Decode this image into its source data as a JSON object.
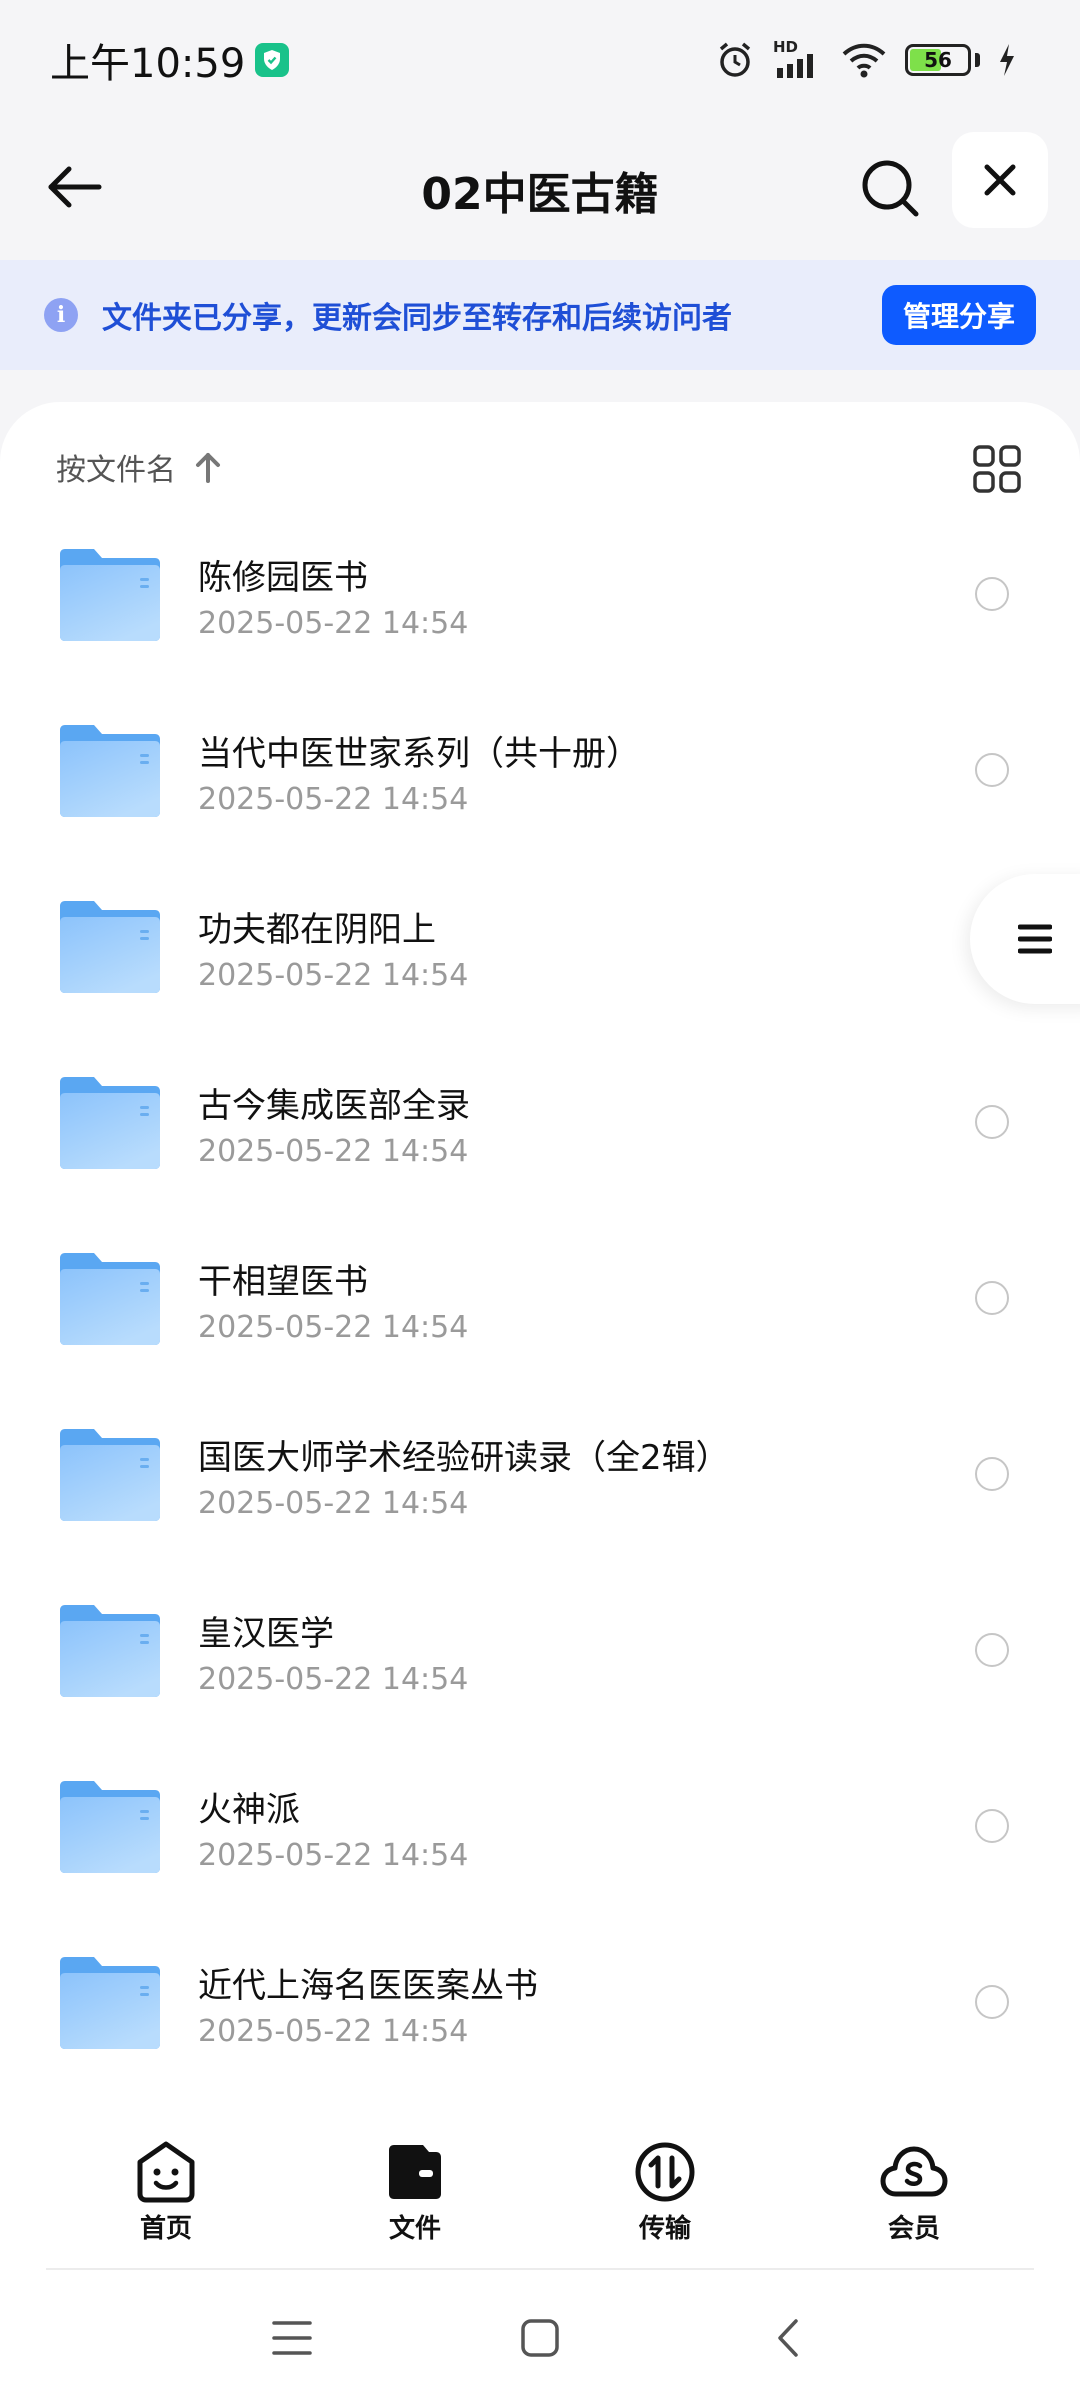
{
  "status_bar": {
    "time": "上午10:59",
    "battery_level": 56,
    "battery_text": "56",
    "network_label": "HD"
  },
  "header": {
    "title": "02中医古籍",
    "back_icon": "arrow-left-icon",
    "search_icon": "search-icon",
    "close_icon": "close-icon"
  },
  "banner": {
    "info_symbol": "i",
    "text": "文件夹已分享，更新会同步至转存和后续访问者",
    "button_label": "管理分享",
    "accent_color": "#0e5bff"
  },
  "sort": {
    "label": "按文件名"
  },
  "files": [
    {
      "name": "陈修园医书",
      "date": "2025-05-22 14:54"
    },
    {
      "name": "当代中医世家系列（共十册）",
      "date": "2025-05-22 14:54"
    },
    {
      "name": "功夫都在阴阳上",
      "date": "2025-05-22 14:54"
    },
    {
      "name": "古今集成医部全录",
      "date": "2025-05-22 14:54"
    },
    {
      "name": "干相望医书",
      "date": "2025-05-22 14:54"
    },
    {
      "name": "国医大师学术经验研读录（全2辑）",
      "date": "2025-05-22 14:54"
    },
    {
      "name": "皇汉医学",
      "date": "2025-05-22 14:54"
    },
    {
      "name": "火神派",
      "date": "2025-05-22 14:54"
    },
    {
      "name": "近代上海名医医案丛书",
      "date": "2025-05-22 14:54"
    }
  ],
  "bottom_nav": {
    "home": "首页",
    "files": "文件",
    "transfer": "传输",
    "vip": "会员"
  }
}
